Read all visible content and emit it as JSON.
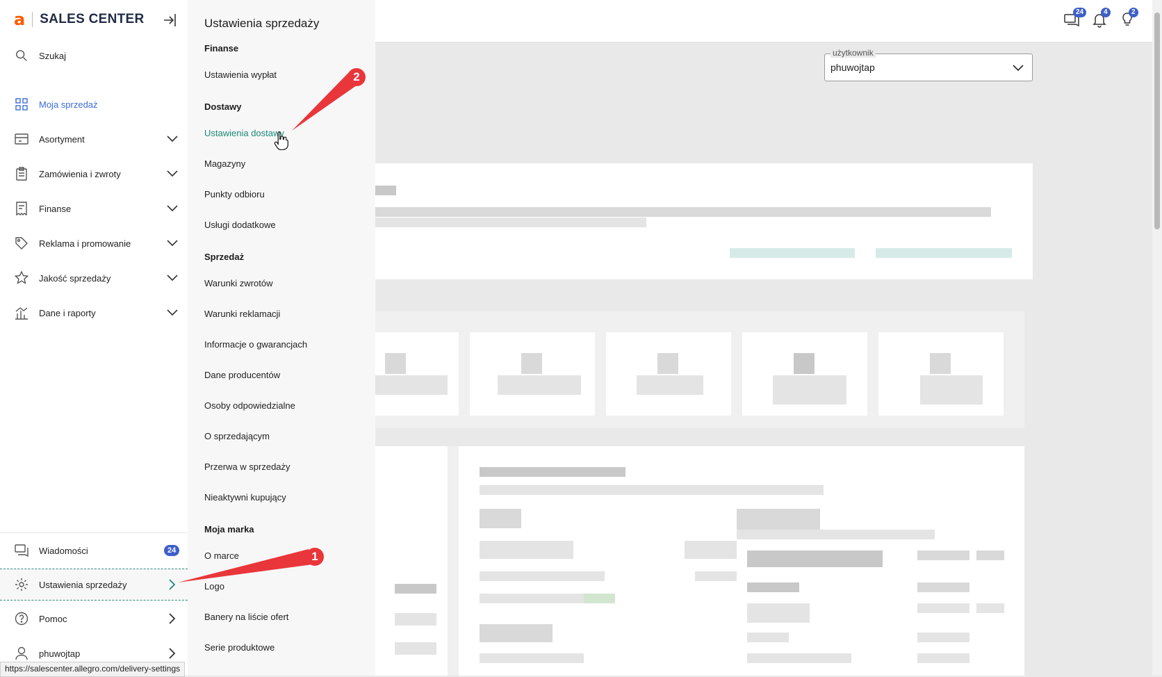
{
  "brand": {
    "logo_letter": "a",
    "name": "SALES CENTER"
  },
  "sidebar": {
    "search_label": "Szukaj",
    "items": [
      {
        "label": "Moja sprzedaż",
        "icon": "grid-icon"
      },
      {
        "label": "Asortyment",
        "icon": "store-icon"
      },
      {
        "label": "Zamówienia i zwroty",
        "icon": "clipboard-icon"
      },
      {
        "label": "Finanse",
        "icon": "receipt-icon"
      },
      {
        "label": "Reklama i promowanie",
        "icon": "tag-icon"
      },
      {
        "label": "Jakość sprzedaży",
        "icon": "star-icon"
      },
      {
        "label": "Dane i raporty",
        "icon": "chart-icon"
      }
    ],
    "bottom": {
      "messages": {
        "label": "Wiadomości",
        "badge": "24"
      },
      "settings": {
        "label": "Ustawienia sprzedaży"
      },
      "help": {
        "label": "Pomoc"
      },
      "user": {
        "label": "phuwojtap"
      }
    }
  },
  "flyout": {
    "title": "Ustawienia sprzedaży",
    "sections": {
      "finanse": "Finanse",
      "dostawy": "Dostawy",
      "sprzedaz": "Sprzedaż",
      "moja_marka": "Moja marka"
    },
    "items": {
      "wyplat": "Ustawienia wypłat",
      "dostawy": "Ustawienia dostawy",
      "magazyny": "Magazyny",
      "punkty": "Punkty odbioru",
      "uslugi": "Usługi dodatkowe",
      "zwrotow": "Warunki zwrotów",
      "reklamacji": "Warunki reklamacji",
      "gwarancje": "Informacje o gwarancjach",
      "producenci": "Dane producentów",
      "osoby": "Osoby odpowiedzialne",
      "sprzedajacy": "O sprzedającym",
      "przerwa": "Przerwa w sprzedaży",
      "nieaktywni": "Nieaktywni kupujący",
      "marka": "O marce",
      "logo": "Logo",
      "banery": "Banery na liście ofert",
      "serie": "Serie produktowe"
    }
  },
  "topbar": {
    "messages_badge": "24",
    "notifications_badge": "4",
    "tips_badge": "2"
  },
  "user_select": {
    "legend": "użytkownik",
    "value": "phuwojtap"
  },
  "status_url": "https://salescenter.allegro.com/delivery-settings",
  "annotations": {
    "marker1": "1",
    "marker2": "2"
  },
  "colors": {
    "accent": "#ff5a00",
    "link": "#3d6bd9",
    "hover": "#1b8a78",
    "badge": "#3d5fc9",
    "marker": "#e9363b"
  }
}
